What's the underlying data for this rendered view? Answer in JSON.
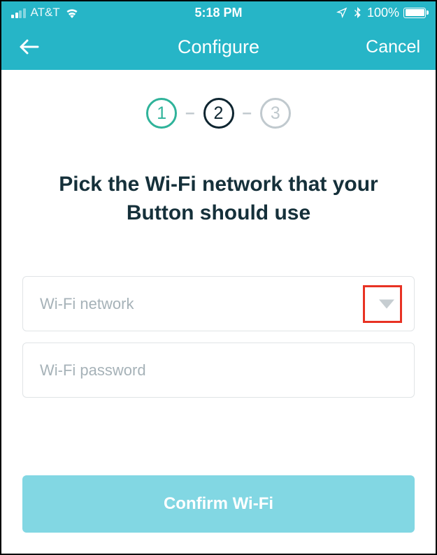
{
  "statusBar": {
    "carrier": "AT&T",
    "time": "5:18 PM",
    "batteryPercent": "100%"
  },
  "nav": {
    "title": "Configure",
    "cancel": "Cancel"
  },
  "stepper": {
    "step1": "1",
    "step2": "2",
    "step3": "3",
    "separator": "–"
  },
  "heading": "Pick the Wi-Fi network that your Button should use",
  "fields": {
    "networkPlaceholder": "Wi-Fi network",
    "passwordPlaceholder": "Wi-Fi password"
  },
  "confirmLabel": "Confirm Wi-Fi"
}
